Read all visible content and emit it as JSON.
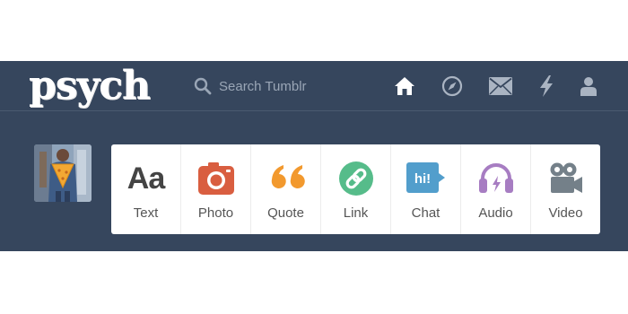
{
  "header": {
    "logo": "psych",
    "search": {
      "placeholder": "Search Tumblr",
      "value": ""
    },
    "nav": [
      {
        "name": "home-icon"
      },
      {
        "name": "compass-icon"
      },
      {
        "name": "mail-icon"
      },
      {
        "name": "lightning-icon"
      },
      {
        "name": "user-icon"
      }
    ]
  },
  "avatar": {
    "description_icon": "avatar-icon"
  },
  "post_types": [
    {
      "label": "Text",
      "icon_text": "Aa",
      "color": "#444444"
    },
    {
      "label": "Photo",
      "color": "#d95e40"
    },
    {
      "label": "Quote",
      "color": "#f2992e"
    },
    {
      "label": "Link",
      "color": "#56bc8a"
    },
    {
      "label": "Chat",
      "icon_text": "hi!",
      "color": "#529ecc"
    },
    {
      "label": "Audio",
      "color": "#a77dc2"
    },
    {
      "label": "Video",
      "color": "#748089"
    }
  ]
}
